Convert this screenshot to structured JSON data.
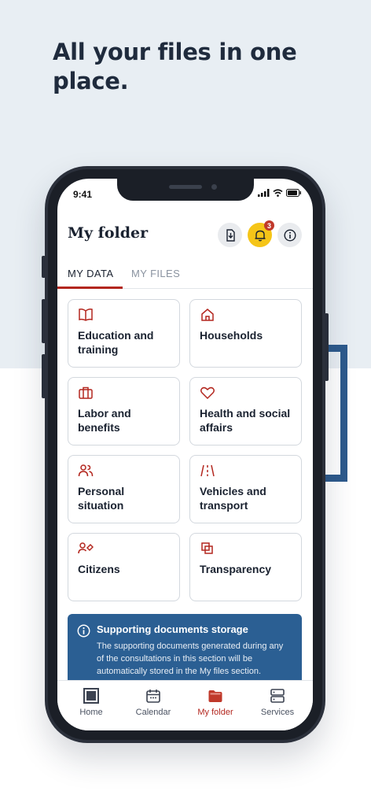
{
  "headline": "All your files in one place.",
  "status": {
    "time": "9:41"
  },
  "app": {
    "title": "My folder",
    "notification_count": "3"
  },
  "tabs": [
    {
      "label": "MY DATA",
      "active": true
    },
    {
      "label": "MY FILES",
      "active": false
    }
  ],
  "categories": [
    {
      "label": "Education and training",
      "icon": "book-icon"
    },
    {
      "label": "Households",
      "icon": "house-icon"
    },
    {
      "label": "Labor and benefits",
      "icon": "briefcase-icon"
    },
    {
      "label": "Health and social affairs",
      "icon": "heart-icon"
    },
    {
      "label": "Personal situation",
      "icon": "people-icon"
    },
    {
      "label": "Vehicles and transport",
      "icon": "road-icon"
    },
    {
      "label": "Citizens",
      "icon": "citizen-tag-icon"
    },
    {
      "label": "Transparency",
      "icon": "transparency-icon"
    }
  ],
  "info": {
    "title": "Supporting documents storage",
    "text": "The supporting documents generated during any of the consultations in this section will be automatically stored in the My files section."
  },
  "nav": [
    {
      "label": "Home",
      "icon": "home-icon"
    },
    {
      "label": "Calendar",
      "icon": "calendar-icon"
    },
    {
      "label": "My folder",
      "icon": "folder-icon",
      "active": true
    },
    {
      "label": "Services",
      "icon": "services-icon"
    }
  ],
  "colors": {
    "accent": "#b3261e",
    "bell": "#f5c518",
    "info_bg": "#2b5f93",
    "headline": "#1f2b3d"
  }
}
